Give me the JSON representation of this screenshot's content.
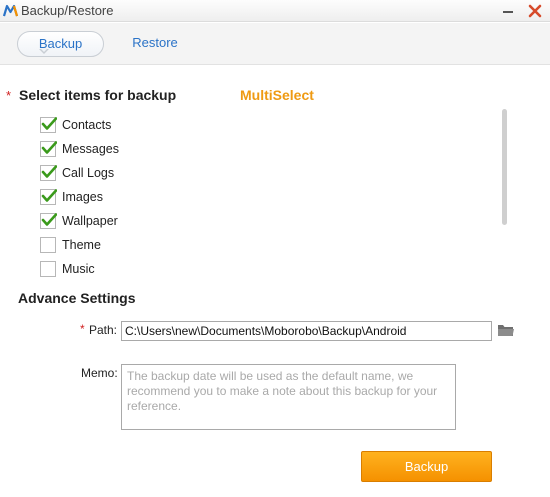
{
  "window": {
    "title": "Backup/Restore",
    "logo_icon": "moborobo-logo-icon",
    "minimize_icon": "minimize-icon",
    "close_icon": "close-icon"
  },
  "tabs": [
    {
      "label": "Backup",
      "active": true
    },
    {
      "label": "Restore",
      "active": false
    }
  ],
  "backup_items": {
    "required_mark": "*",
    "title": "Select items for backup",
    "multiselect_label": "MultiSelect",
    "items": [
      {
        "label": "Contacts",
        "checked": true
      },
      {
        "label": "Messages",
        "checked": true
      },
      {
        "label": "Call Logs",
        "checked": true
      },
      {
        "label": "Images",
        "checked": true
      },
      {
        "label": "Wallpaper",
        "checked": true
      },
      {
        "label": "Theme",
        "checked": false
      },
      {
        "label": "Music",
        "checked": false
      }
    ]
  },
  "advance_settings": {
    "title": "Advance Settings",
    "path_required_mark": "*",
    "path_label": "Path:",
    "path_value": "C:\\Users\\new\\Documents\\Moborobo\\Backup\\Android",
    "folder_icon": "folder-icon",
    "memo_label": "Memo:",
    "memo_placeholder": "The backup date will be used as the default name, we recommend you to make a note about this backup for your reference.",
    "memo_value": ""
  },
  "actions": {
    "backup_label": "Backup"
  },
  "colors": {
    "accent_orange": "#f59100",
    "tab_blue": "#2b73c7",
    "check_green": "#3a9a1b",
    "required_red": "#d02020",
    "close_red": "#d64a2a"
  }
}
